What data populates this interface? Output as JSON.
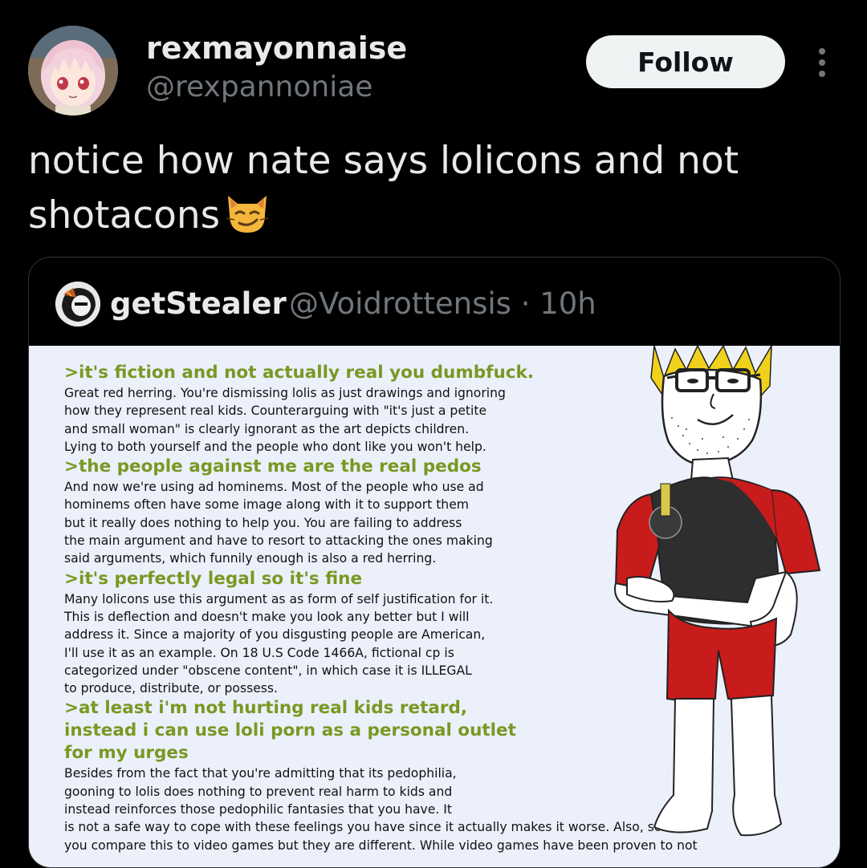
{
  "tweet": {
    "author": {
      "display_name": "rexmayonnaise",
      "handle": "@rexpannoniae",
      "avatar_icon": "anime-girl-avatar"
    },
    "follow_label": "Follow",
    "more_icon": "more-vertical-icon",
    "text_line1": "notice how nate says lolicons and not",
    "text_line2": "shotacons",
    "emoji": "smirking-cat-emoji"
  },
  "quote": {
    "display_name": "getStealer",
    "handle_time": "@Voidrottensis · 10h",
    "avatar_icon": "character-avatar",
    "image": {
      "sections": [
        {
          "heading": [
            ">it's fiction and not actually real you dumbfuck."
          ],
          "body": [
            "Great red herring. You're dismissing lolis as just drawings and ignoring",
            "how they represent real kids. Counterarguing with \"it's just a petite",
            "and small woman\" is clearly ignorant as the art depicts children.",
            "Lying to both yourself and the people who dont like you won't help."
          ]
        },
        {
          "heading": [
            ">the people against me are the real pedos"
          ],
          "body": [
            "And now we're using ad hominems. Most of the people who use ad",
            "hominems often have some image along with it to support them",
            "but it really does nothing to help you. You are failing to address",
            "the main argument and have to resort to attacking the ones making",
            "said arguments, which funnily enough is also a red herring."
          ]
        },
        {
          "heading": [
            ">it's perfectly legal so it's fine"
          ],
          "body": [
            "Many lolicons use this argument as as form of self justification for it.",
            "This is deflection and doesn't make you look any better but I will",
            "address it. Since a majority of you disgusting people are American,",
            "I'll use it as an example. On 18 U.S Code 1466A, fictional cp is",
            "categorized under \"obscene content\", in which case it is ILLEGAL",
            "to produce, distribute, or possess."
          ]
        },
        {
          "heading": [
            ">at least i'm not hurting real kids retard,",
            "instead i can use loli porn as a personal outlet",
            "for my urges"
          ],
          "body": [
            "Besides from the fact that you're admitting that its pedophilia,",
            "gooning to lolis does nothing to prevent real harm to kids and",
            "instead reinforces those pedophilic fantasies that you have. It",
            "is not a safe way to cope with these feelings you have since it actually makes it worse. Also, some of",
            "you compare this to video games but they are different. While video games have been proven to not"
          ]
        }
      ],
      "illustration": "wojak-glasses-crossed-arms"
    }
  },
  "colors": {
    "background": "#000000",
    "text_primary": "#e7e9ea",
    "text_secondary": "#71767b",
    "follow_bg": "#eff3f4",
    "greentext": "#789922",
    "image_bg": "#ecf0fb",
    "card_border": "#2f3336"
  }
}
